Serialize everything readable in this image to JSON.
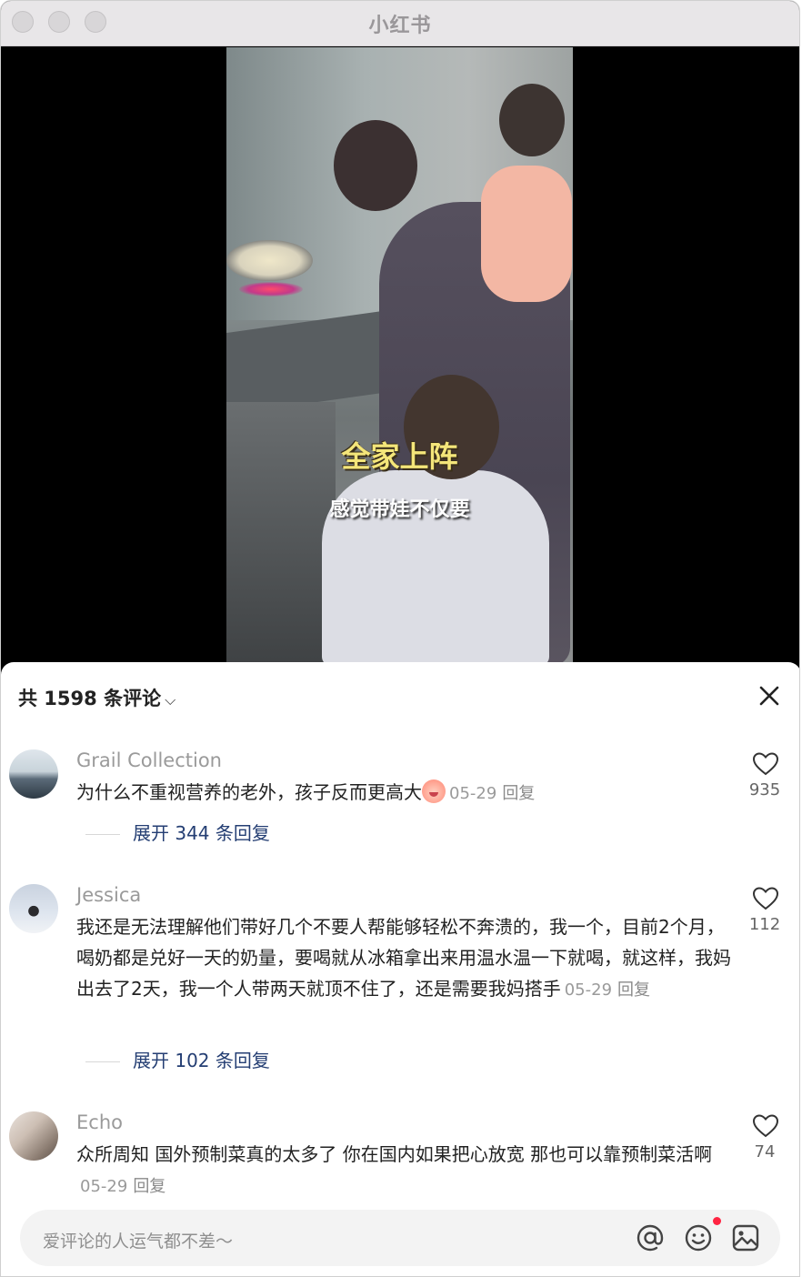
{
  "window": {
    "title": "小红书"
  },
  "video": {
    "caption_top": "全家上阵",
    "caption_bottom": "感觉带娃不仅要"
  },
  "comments_header": {
    "count_label": "共 1598 条评论"
  },
  "comments": [
    {
      "user": "Grail Collection",
      "text": "为什么不重视营养的老外，孩子反而更高大",
      "date": "05-29",
      "reply": "回复",
      "likes": "935",
      "expand": "展开 344 条回复",
      "has_emoji": true
    },
    {
      "user": "Jessica",
      "text": "我还是无法理解他们带好几个不要人帮能够轻松不奔溃的，我一个，目前2个月，喝奶都是兑好一天的奶量，要喝就从冰箱拿出来用温水温一下就喝，就这样，我妈出去了2天，我一个人带两天就顶不住了，还是需要我妈搭手",
      "date": "05-29",
      "reply": "回复",
      "likes": "112",
      "expand": "展开 102 条回复"
    },
    {
      "user": "Echo",
      "text": "众所周知 国外预制菜真的太多了 你在国内如果把心放宽 那也可以靠预制菜活啊",
      "date": "05-29",
      "reply": "回复",
      "likes": "74"
    }
  ],
  "input": {
    "placeholder": "爱评论的人运气都不差～"
  },
  "icons": [
    "close-icon",
    "heart-icon",
    "at-icon",
    "emoji-icon",
    "image-icon",
    "chevron-down-icon"
  ],
  "colors": {
    "link": "#243e73",
    "accent": "#ff2442"
  }
}
